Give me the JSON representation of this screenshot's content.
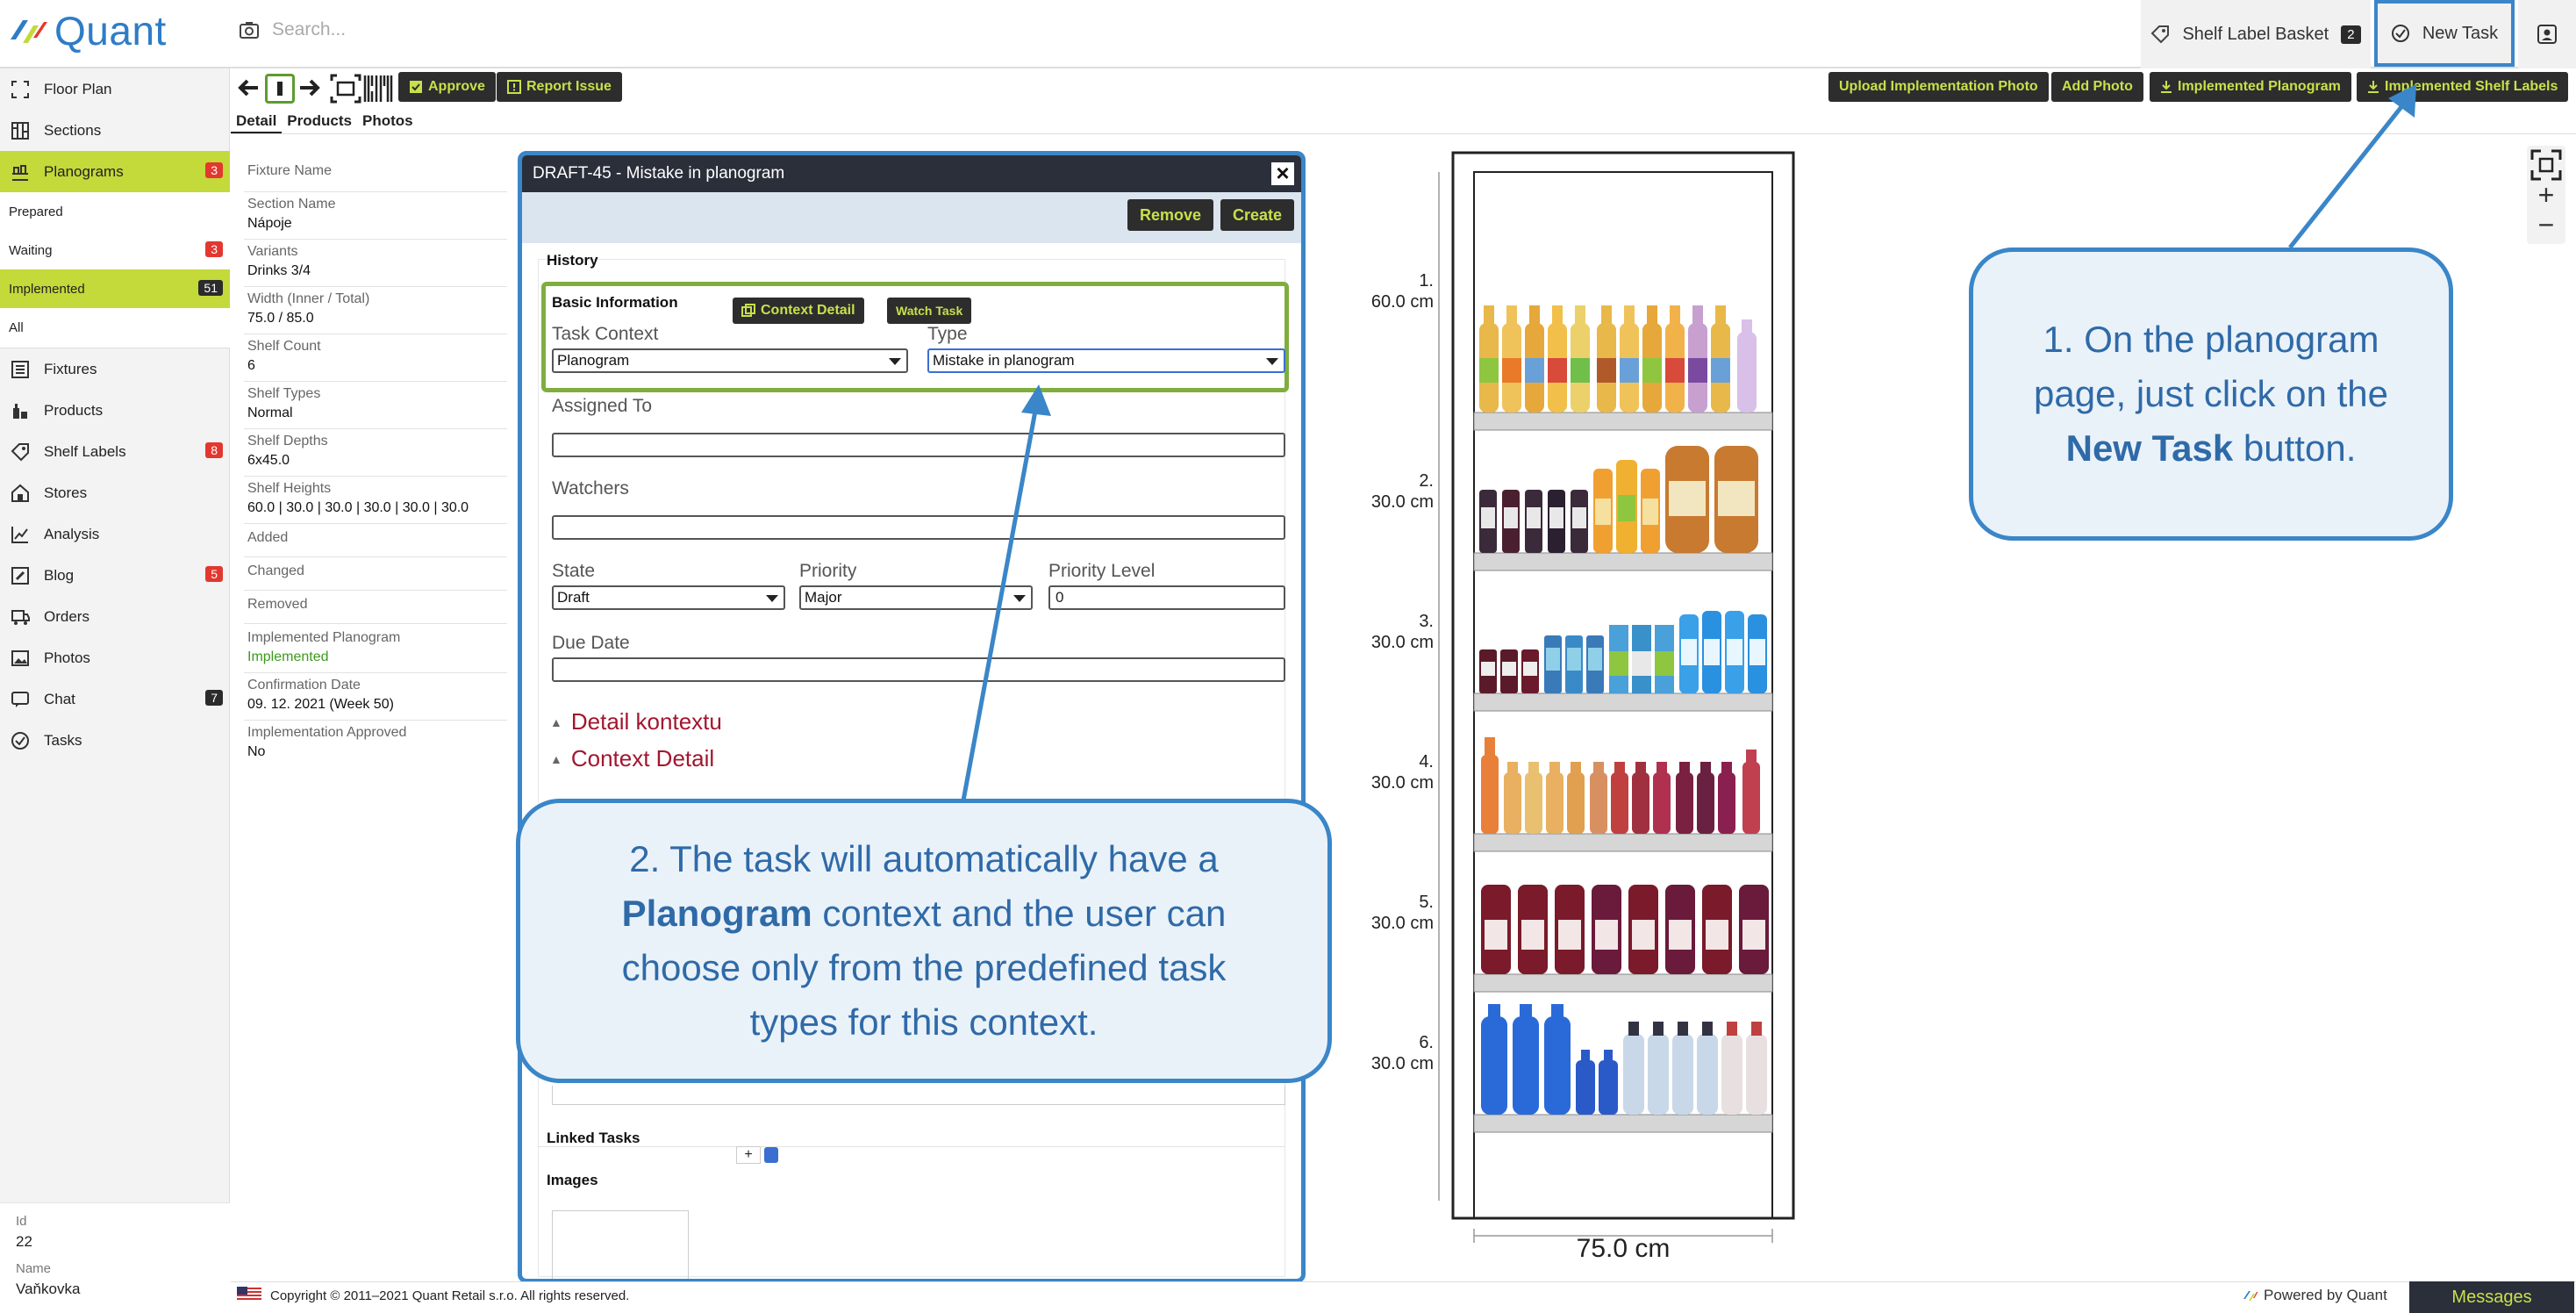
{
  "app": {
    "logo_text": "Quant",
    "search_placeholder": "Search..."
  },
  "topbar": {
    "shelf_label_basket": "Shelf Label Basket",
    "shelf_label_basket_count": "2",
    "new_task": "New Task"
  },
  "sidebar": {
    "items": [
      {
        "label": "Floor Plan",
        "icon": "floor-plan-icon"
      },
      {
        "label": "Sections",
        "icon": "sections-icon"
      },
      {
        "label": "Planograms",
        "icon": "planograms-icon",
        "badge": "3",
        "active": true
      },
      {
        "label": "Fixtures",
        "icon": "fixtures-icon"
      },
      {
        "label": "Products",
        "icon": "products-icon"
      },
      {
        "label": "Shelf Labels",
        "icon": "shelf-labels-icon",
        "badge": "8"
      },
      {
        "label": "Stores",
        "icon": "stores-icon"
      },
      {
        "label": "Analysis",
        "icon": "analysis-icon"
      },
      {
        "label": "Blog",
        "icon": "blog-icon",
        "badge": "5"
      },
      {
        "label": "Orders",
        "icon": "orders-icon"
      },
      {
        "label": "Photos",
        "icon": "photos-icon"
      },
      {
        "label": "Chat",
        "icon": "chat-icon",
        "badge": "7"
      },
      {
        "label": "Tasks",
        "icon": "tasks-icon"
      }
    ],
    "sub_items": [
      {
        "label": "Prepared"
      },
      {
        "label": "Waiting",
        "badge": "3"
      },
      {
        "label": "Implemented",
        "badge": "51",
        "active": true
      },
      {
        "label": "All"
      }
    ],
    "footer": {
      "id_label": "Id",
      "id_value": "22",
      "name_label": "Name",
      "name_value": "Vaňkovka"
    }
  },
  "toolbar": {
    "approve": "Approve",
    "report_issue": "Report Issue",
    "upload_photo": "Upload Implementation Photo",
    "add_photo": "Add Photo",
    "implemented_planogram": "Implemented Planogram",
    "implemented_shelf_labels": "Implemented Shelf Labels"
  },
  "tabs": [
    "Detail",
    "Products",
    "Photos"
  ],
  "detail": {
    "fixture_name_label": "Fixture Name",
    "section_name_label": "Section Name",
    "section_name_value": "Nápoje",
    "variants_label": "Variants",
    "variants_value": "Drinks 3/4",
    "width_label": "Width (Inner / Total)",
    "width_value": "75.0 / 85.0",
    "shelf_count_label": "Shelf Count",
    "shelf_count_value": "6",
    "shelf_types_label": "Shelf Types",
    "shelf_types_value": "Normal",
    "shelf_depths_label": "Shelf Depths",
    "shelf_depths_value": "6x45.0",
    "shelf_heights_label": "Shelf Heights",
    "shelf_heights_value": "60.0 | 30.0 | 30.0 | 30.0 | 30.0 | 30.0",
    "added_label": "Added",
    "changed_label": "Changed",
    "removed_label": "Removed",
    "impl_planogram_label": "Implemented Planogram",
    "impl_planogram_value": "Implemented",
    "confirmation_label": "Confirmation Date",
    "confirmation_value": "09. 12. 2021 (Week 50)",
    "impl_approved_label": "Implementation Approved",
    "impl_approved_value": "No"
  },
  "dialog": {
    "title": "DRAFT-45 - Mistake in planogram",
    "remove": "Remove",
    "create": "Create",
    "history": "History",
    "basic_info": "Basic Information",
    "context_detail_btn": "Context Detail",
    "watch_task_btn": "Watch Task",
    "task_context_label": "Task Context",
    "task_context_value": "Planogram",
    "type_label": "Type",
    "type_value": "Mistake in planogram",
    "assigned_to_label": "Assigned To",
    "watchers_label": "Watchers",
    "state_label": "State",
    "state_value": "Draft",
    "priority_label": "Priority",
    "priority_value": "Major",
    "priority_level_label": "Priority Level",
    "priority_level_value": "0",
    "due_date_label": "Due Date",
    "detail_kontextu": "Detail kontextu",
    "context_detail": "Context Detail",
    "linked_tasks": "Linked Tasks",
    "linked_add": "+",
    "images": "Images"
  },
  "planogram": {
    "shelves": [
      {
        "num": "1.",
        "height": "60.0 cm"
      },
      {
        "num": "2.",
        "height": "30.0 cm"
      },
      {
        "num": "3.",
        "height": "30.0 cm"
      },
      {
        "num": "4.",
        "height": "30.0 cm"
      },
      {
        "num": "5.",
        "height": "30.0 cm"
      },
      {
        "num": "6.",
        "height": "30.0 cm"
      }
    ],
    "width_label": "75.0 cm"
  },
  "zoom": {
    "plus": "+",
    "minus": "−"
  },
  "callouts": {
    "one_a": "1. On the planogram page, just click on the",
    "one_bold": "New Task",
    "one_b": "button.",
    "two_a": "2. The task will automatically have a",
    "two_bold": "Planogram",
    "two_b": "context and the user can choose only from the predefined task types for this context."
  },
  "footer": {
    "copyright": "Copyright © 2011–2021 Quant Retail s.r.o. All rights reserved.",
    "powered_by": "Powered by Quant",
    "messages": "Messages"
  },
  "colors": {
    "accent": "#c4d93a",
    "brand": "#2f7cc6",
    "callout_border": "#3a86c8",
    "badge_red": "#e2382f"
  }
}
